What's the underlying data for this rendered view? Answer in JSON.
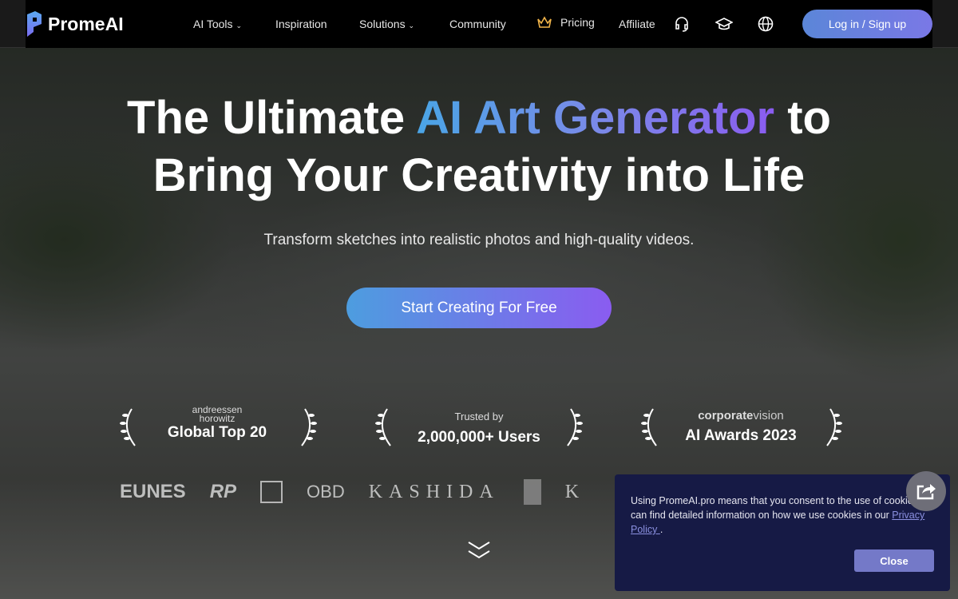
{
  "nav": {
    "brand": "PromeAI",
    "items": [
      {
        "label": "AI Tools",
        "dropdown": true
      },
      {
        "label": "Inspiration"
      },
      {
        "label": "Solutions",
        "dropdown": true
      },
      {
        "label": "Community"
      },
      {
        "label": "Pricing",
        "icon": "crown-icon"
      },
      {
        "label": "Affiliate"
      }
    ],
    "icons": [
      "headset-icon",
      "graduation-cap-icon",
      "globe-icon"
    ],
    "login": "Log in / Sign up"
  },
  "hero": {
    "title_pre": "The Ultimate ",
    "title_highlight": "AI Art Generator",
    "title_post": " to",
    "title_line2": "Bring Your Creativity into Life",
    "subtitle": "Transform sketches into realistic photos and high-quality videos.",
    "cta": "Start Creating For Free"
  },
  "awards": [
    {
      "top": "andreessen horowitz",
      "main": "Global Top 20"
    },
    {
      "top": "Trusted by",
      "main": "2,000,000+ Users"
    },
    {
      "top_bold": "corporate",
      "top_light": "vision",
      "main": "AI Awards 2023"
    }
  ],
  "brands": [
    "EUNES",
    "RP",
    "OBD",
    "KASHIDA",
    "K"
  ],
  "cookie": {
    "text": "Using PromeAI.pro means that you consent to the use of cookies. can find detailed information on how we use cookies in our ",
    "link": "Privacy Policy ",
    "end": ".",
    "close": "Close"
  },
  "colors": {
    "accent_start": "#4d9ddf",
    "accent_end": "#8a5cf0",
    "cookie_bg": "#161a45"
  }
}
